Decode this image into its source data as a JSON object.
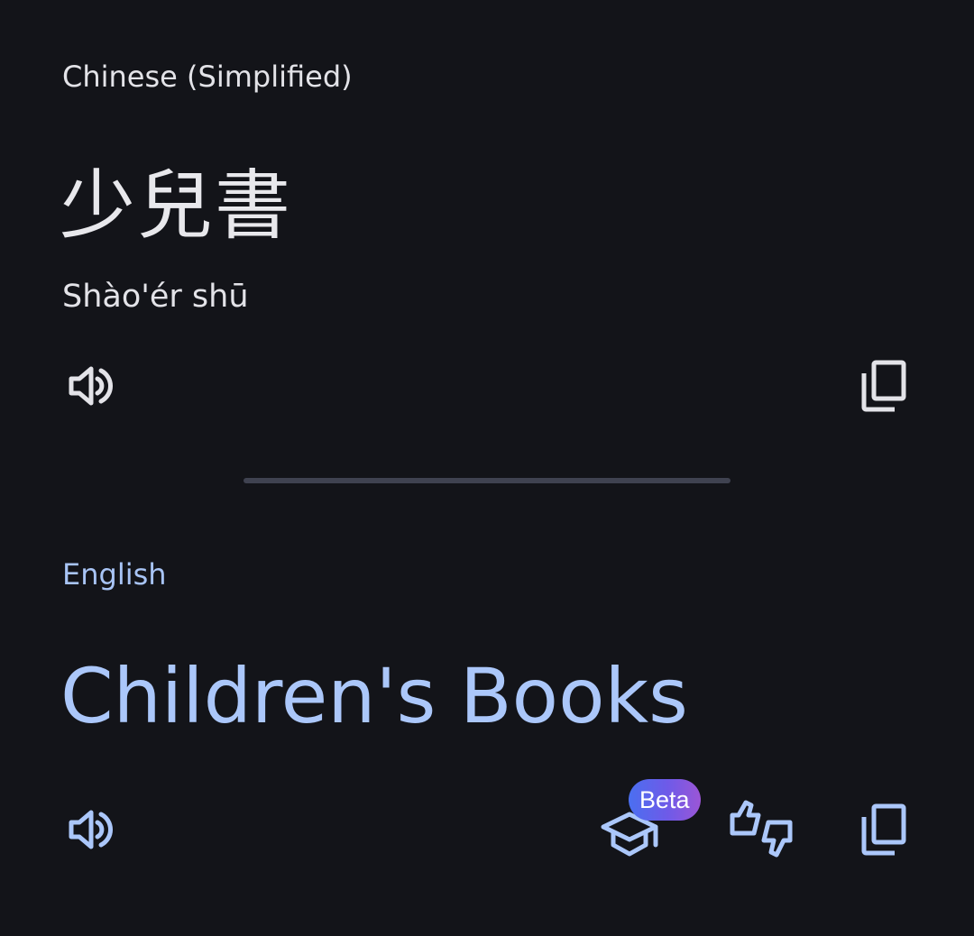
{
  "source": {
    "language": "Chinese (Simplified)",
    "text": "少兒書",
    "transliteration": "Shào'ér shū",
    "speak_icon": "volume-icon",
    "copy_icon": "copy-icon"
  },
  "target": {
    "language": "English",
    "text": "Children's Books",
    "speak_icon": "volume-icon",
    "learn_icon": "graduation-cap-icon",
    "learn_badge": "Beta",
    "rate_icon": "thumbs-up-down-icon",
    "copy_icon": "copy-icon"
  },
  "colors": {
    "background": "#131419",
    "source_text": "#e3e3e8",
    "target_text": "#abc7fa",
    "divider": "#3f4250"
  }
}
